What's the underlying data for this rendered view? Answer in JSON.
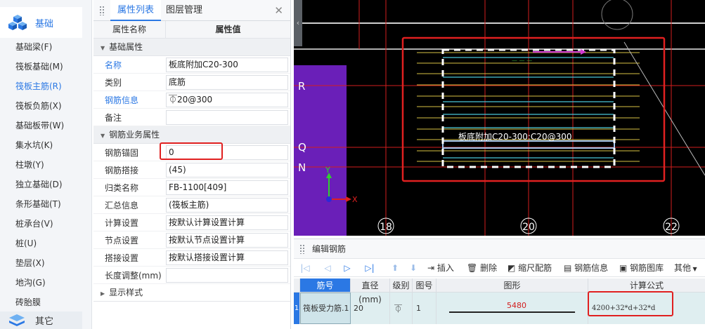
{
  "nav": {
    "header_label": "基础",
    "items": [
      "基础梁(F)",
      "筏板基础(M)",
      "筏板主筋(R)",
      "筏板负筋(X)",
      "基础板带(W)",
      "集水坑(K)",
      "柱墩(Y)",
      "独立基础(D)",
      "条形基础(T)",
      "桩承台(V)",
      "桩(U)",
      "垫层(X)",
      "地沟(G)",
      "砖胎膜"
    ],
    "active_index": 2,
    "footer_label": "其它"
  },
  "props": {
    "tabs": [
      "属性列表",
      "图层管理"
    ],
    "col_name": "属性名称",
    "col_value": "属性值",
    "group1": "基础属性",
    "group2": "钢筋业务属性",
    "group3": "显示样式",
    "rows1": [
      {
        "k": "名称",
        "v": "板底附加C20-300"
      },
      {
        "k": "类别",
        "v": "底筋"
      },
      {
        "k": "钢筋信息",
        "v": "⏁20@300"
      },
      {
        "k": "备注",
        "v": ""
      }
    ],
    "rows2": [
      {
        "k": "钢筋锚固",
        "v": "0"
      },
      {
        "k": "钢筋搭接",
        "v": "(45)"
      },
      {
        "k": "归类名称",
        "v": "FB-1100[409]"
      },
      {
        "k": "汇总信息",
        "v": "(筏板主筋)"
      },
      {
        "k": "计算设置",
        "v": "按默认计算设置计算"
      },
      {
        "k": "节点设置",
        "v": "按默认节点设置计算"
      },
      {
        "k": "搭接设置",
        "v": "按默认搭接设置计算"
      },
      {
        "k": "长度调整(mm)",
        "v": ""
      }
    ]
  },
  "canvas": {
    "rebar_label": "板底附加C20-300:C20@300",
    "axis_labels": [
      "R",
      "Q",
      "N"
    ],
    "grid_numbers": [
      "18",
      "20",
      "22"
    ],
    "ucs_y": "Y",
    "ucs_x": "X"
  },
  "edit": {
    "title": "编辑钢筋",
    "tools": [
      "插入",
      "删除",
      "缩尺配筋",
      "钢筋信息",
      "钢筋图库",
      "其他"
    ],
    "headers": [
      "筋号",
      "直径(mm)",
      "级别",
      "图号",
      "图形",
      "计算公式"
    ],
    "row": {
      "index": "1",
      "name": "筏板受力筋.1",
      "diameter": "20",
      "grade": "⏁",
      "shape_no": "1",
      "length": "5480",
      "formula": "4200+32*d+32*d"
    }
  },
  "colors": {
    "accent": "#2b78e4",
    "highlight_red": "#e02020",
    "purple_wall": "#6a1fb8"
  }
}
